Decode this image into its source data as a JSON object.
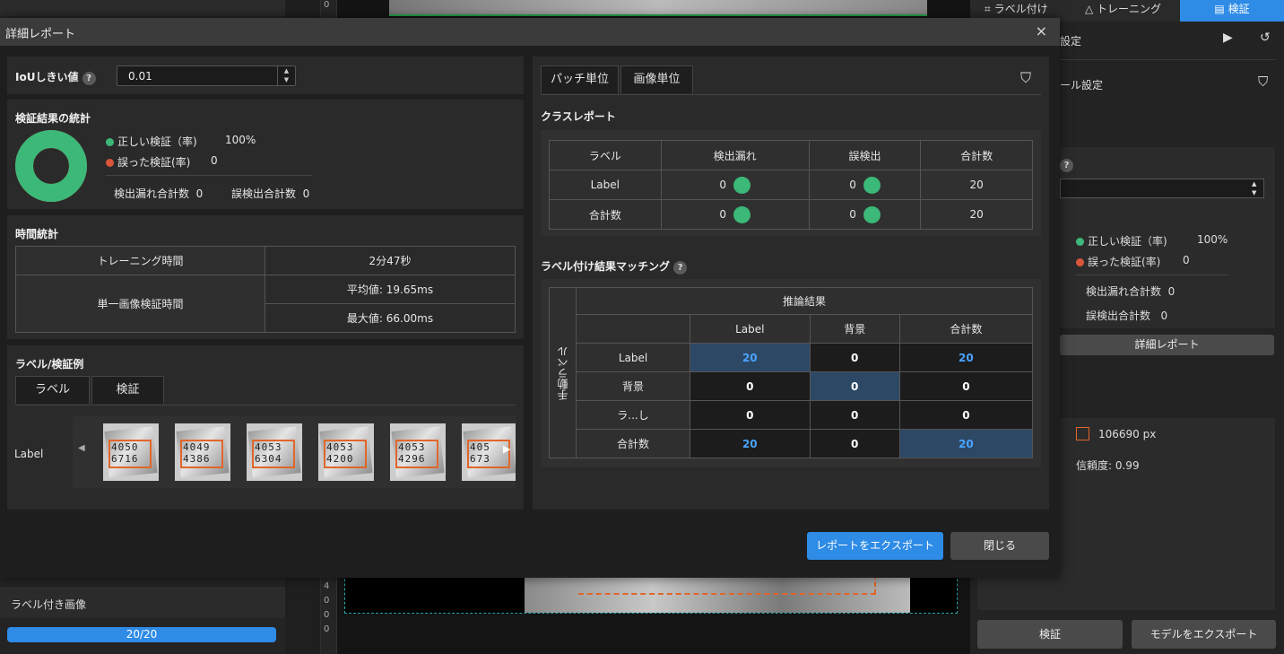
{
  "background": {
    "labeled_images_label": "ラベル付き画像",
    "progress_text": "20/20",
    "ruler_digits": [
      "4",
      "0",
      "0",
      "0"
    ],
    "top_ruler_digit": "0",
    "tabs": [
      "ラベル付け",
      "トレーニング",
      "検証"
    ],
    "right_panel": {
      "header_suffix": "設定",
      "tool_setting_suffix": "ール設定",
      "correct_label": "正しい検証（率)",
      "correct_value": "100%",
      "wrong_label": "誤った検証(率)",
      "wrong_value": "0",
      "missed_total_label": "検出漏れ合計数",
      "missed_total_value": "0",
      "false_total_label": "誤検出合計数",
      "false_total_value": "0",
      "detail_report_button": "詳細レポート",
      "area_value": "106690 px",
      "confidence": "信頼度: 0.99",
      "verify_button": "検証",
      "export_model_button": "モデルをエクスポート"
    }
  },
  "dialog": {
    "title": "詳細レポート",
    "close": "×",
    "iou": {
      "label": "IoUしきい値",
      "help": "?",
      "value": "0.01"
    },
    "stats": {
      "title": "検証結果の統計",
      "correct_label": "正しい検証（率)",
      "correct_value": "100%",
      "wrong_label": "誤った検証(率)",
      "wrong_value": "0",
      "missed_total_label": "検出漏れ合計数",
      "missed_total_value": "0",
      "false_total_label": "誤検出合計数",
      "false_total_value": "0",
      "correct_fraction": 1.0,
      "colors": {
        "correct": "#3cb878",
        "wrong": "#d9553b"
      }
    },
    "time": {
      "title": "時間統計",
      "training_label": "トレーニング時間",
      "training_value": "2分47秒",
      "single_label": "単一画像検証時間",
      "avg": "平均値: 19.65ms",
      "max": "最大値: 66.00ms"
    },
    "examples": {
      "title": "ラベル/検証例",
      "tabs": [
        "ラベル",
        "検証"
      ],
      "row_label": "Label",
      "thumbnails": [
        {
          "line1": "4050",
          "line2": "6716"
        },
        {
          "line1": "4049",
          "line2": "4386"
        },
        {
          "line1": "4053",
          "line2": "6304"
        },
        {
          "line1": "4053",
          "line2": "4200"
        },
        {
          "line1": "4053",
          "line2": "4296"
        },
        {
          "line1": "405",
          "line2": "673"
        }
      ]
    },
    "right": {
      "tabs": [
        "パッチ単位",
        "画像単位"
      ],
      "class_report": {
        "title": "クラスレポート",
        "headers": [
          "ラベル",
          "検出漏れ",
          "誤検出",
          "合計数"
        ],
        "rows": [
          {
            "label": "Label",
            "missed": "0",
            "false": "0",
            "total": "20"
          },
          {
            "label": "合計数",
            "missed": "0",
            "false": "0",
            "total": "20"
          }
        ]
      },
      "matching": {
        "title": "ラベル付け結果マッチング",
        "help": "?",
        "inference_header": "推論結果",
        "manual_label": "手動ラベル",
        "col_headers": [
          "Label",
          "背景",
          "合計数"
        ],
        "rows": [
          {
            "name": "Label",
            "cells": [
              "20",
              "0",
              "20"
            ]
          },
          {
            "name": "背景",
            "cells": [
              "0",
              "0",
              "0"
            ]
          },
          {
            "name": "ラ...し",
            "cells": [
              "0",
              "0",
              "0"
            ]
          },
          {
            "name": "合計数",
            "cells": [
              "20",
              "0",
              "20"
            ]
          }
        ]
      }
    },
    "buttons": {
      "export": "レポートをエクスポート",
      "close": "閉じる"
    }
  }
}
